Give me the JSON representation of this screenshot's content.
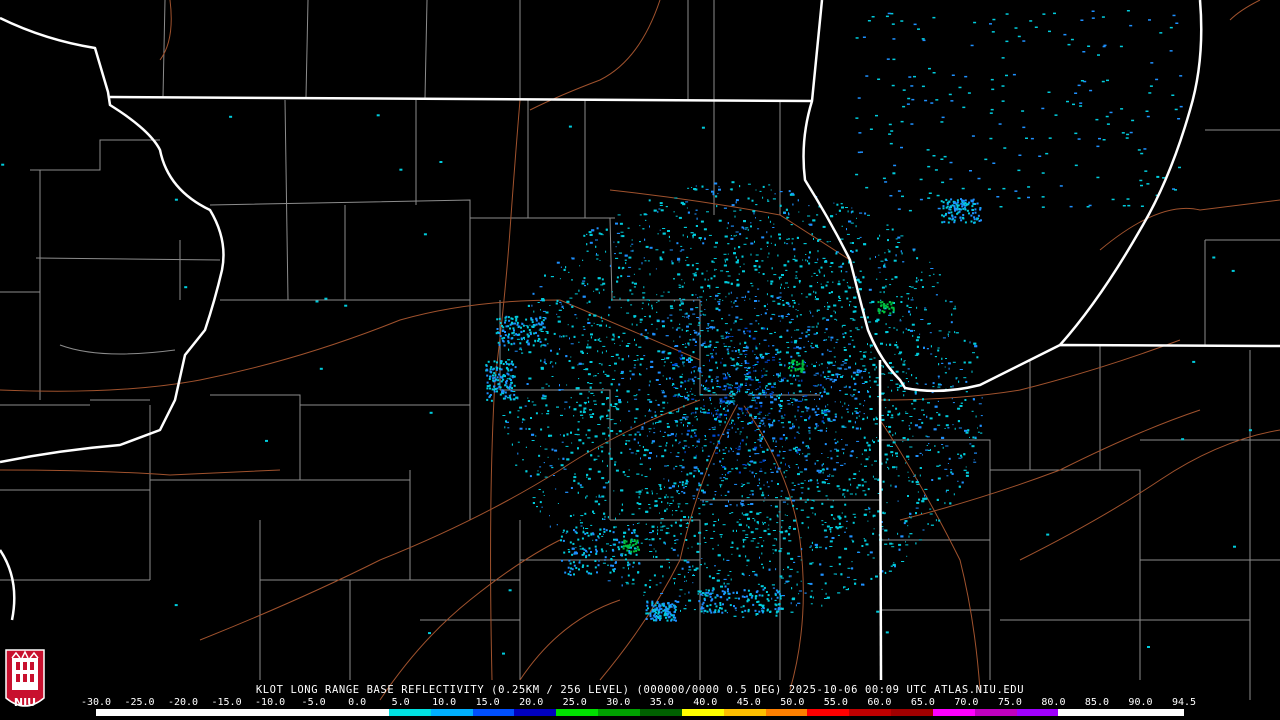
{
  "product": {
    "caption": "KLOT LONG RANGE BASE REFLECTIVITY (0.25KM / 256 LEVEL) (000000/0000 0.5 DEG) 2025-10-06 00:09 UTC   ATLAS.NIU.EDU"
  },
  "logo": {
    "text": "NIU",
    "bg_color": "#c8102e"
  },
  "scale": {
    "labels": [
      "-30.0",
      "-25.0",
      "-20.0",
      "-15.0",
      "-10.0",
      "-5.0",
      "0.0",
      "5.0",
      "10.0",
      "15.0",
      "20.0",
      "25.0",
      "30.0",
      "35.0",
      "40.0",
      "45.0",
      "50.0",
      "55.0",
      "60.0",
      "65.0",
      "70.0",
      "75.0",
      "80.0",
      "85.0",
      "90.0",
      "94.5"
    ],
    "colors": [
      "#ffffff",
      "#ffffff",
      "#ffffff",
      "#ffffff",
      "#ffffff",
      "#ffffff",
      "#ffffff",
      "#00e0e0",
      "#00b0ff",
      "#0050ff",
      "#0000c0",
      "#00e000",
      "#00a000",
      "#006000",
      "#ffff00",
      "#ffc000",
      "#ff8000",
      "#ff0000",
      "#c00000",
      "#a00000",
      "#ff00ff",
      "#c000c0",
      "#a000ff",
      "#ffffff",
      "#ffffff",
      "#ffffff"
    ]
  },
  "map_colors": {
    "background": "#000000",
    "state_borders": "#ffffff",
    "county_lines": "#8c8c8c",
    "highways": "#a0522d",
    "echo_light": "#00ccdd",
    "echo_mid": "#1e90ff",
    "echo_heavy": "#0048d0",
    "echo_green": "#00c040"
  }
}
